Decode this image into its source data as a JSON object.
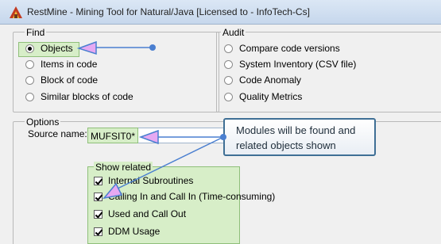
{
  "window": {
    "title": "RestMine - Mining Tool for Natural/Java [Licensed to  - InfoTech-Cs]"
  },
  "find": {
    "legend": "Find",
    "options": [
      {
        "label": "Objects",
        "selected": true
      },
      {
        "label": "Items in code",
        "selected": false
      },
      {
        "label": "Block of code",
        "selected": false
      },
      {
        "label": "Similar blocks of code",
        "selected": false
      }
    ]
  },
  "audit": {
    "legend": "Audit",
    "options": [
      {
        "label": "Compare code versions",
        "selected": false
      },
      {
        "label": "System Inventory (CSV file)",
        "selected": false
      },
      {
        "label": "Code Anomaly",
        "selected": false
      },
      {
        "label": "Quality Metrics",
        "selected": false
      }
    ]
  },
  "options": {
    "legend": "Options",
    "source_name_label": "Source name:",
    "source_name_value": "MUFSIT0*"
  },
  "show_related": {
    "legend": "Show related",
    "items": [
      {
        "label": "Internal Subroutines",
        "checked": true
      },
      {
        "label": "Calling In and Call In (Time-consuming)",
        "checked": true
      },
      {
        "label": "Used and Call Out",
        "checked": true
      },
      {
        "label": "DDM Usage",
        "checked": true
      }
    ]
  },
  "callout": {
    "line1": "Modules will be found and",
    "line2": "related objects shown"
  },
  "colors": {
    "highlight_fill": "#d7eec8",
    "highlight_border": "#8fbf7a",
    "arrow": "#4a7fd0",
    "arrow_head_fill": "#e6a9f2"
  }
}
